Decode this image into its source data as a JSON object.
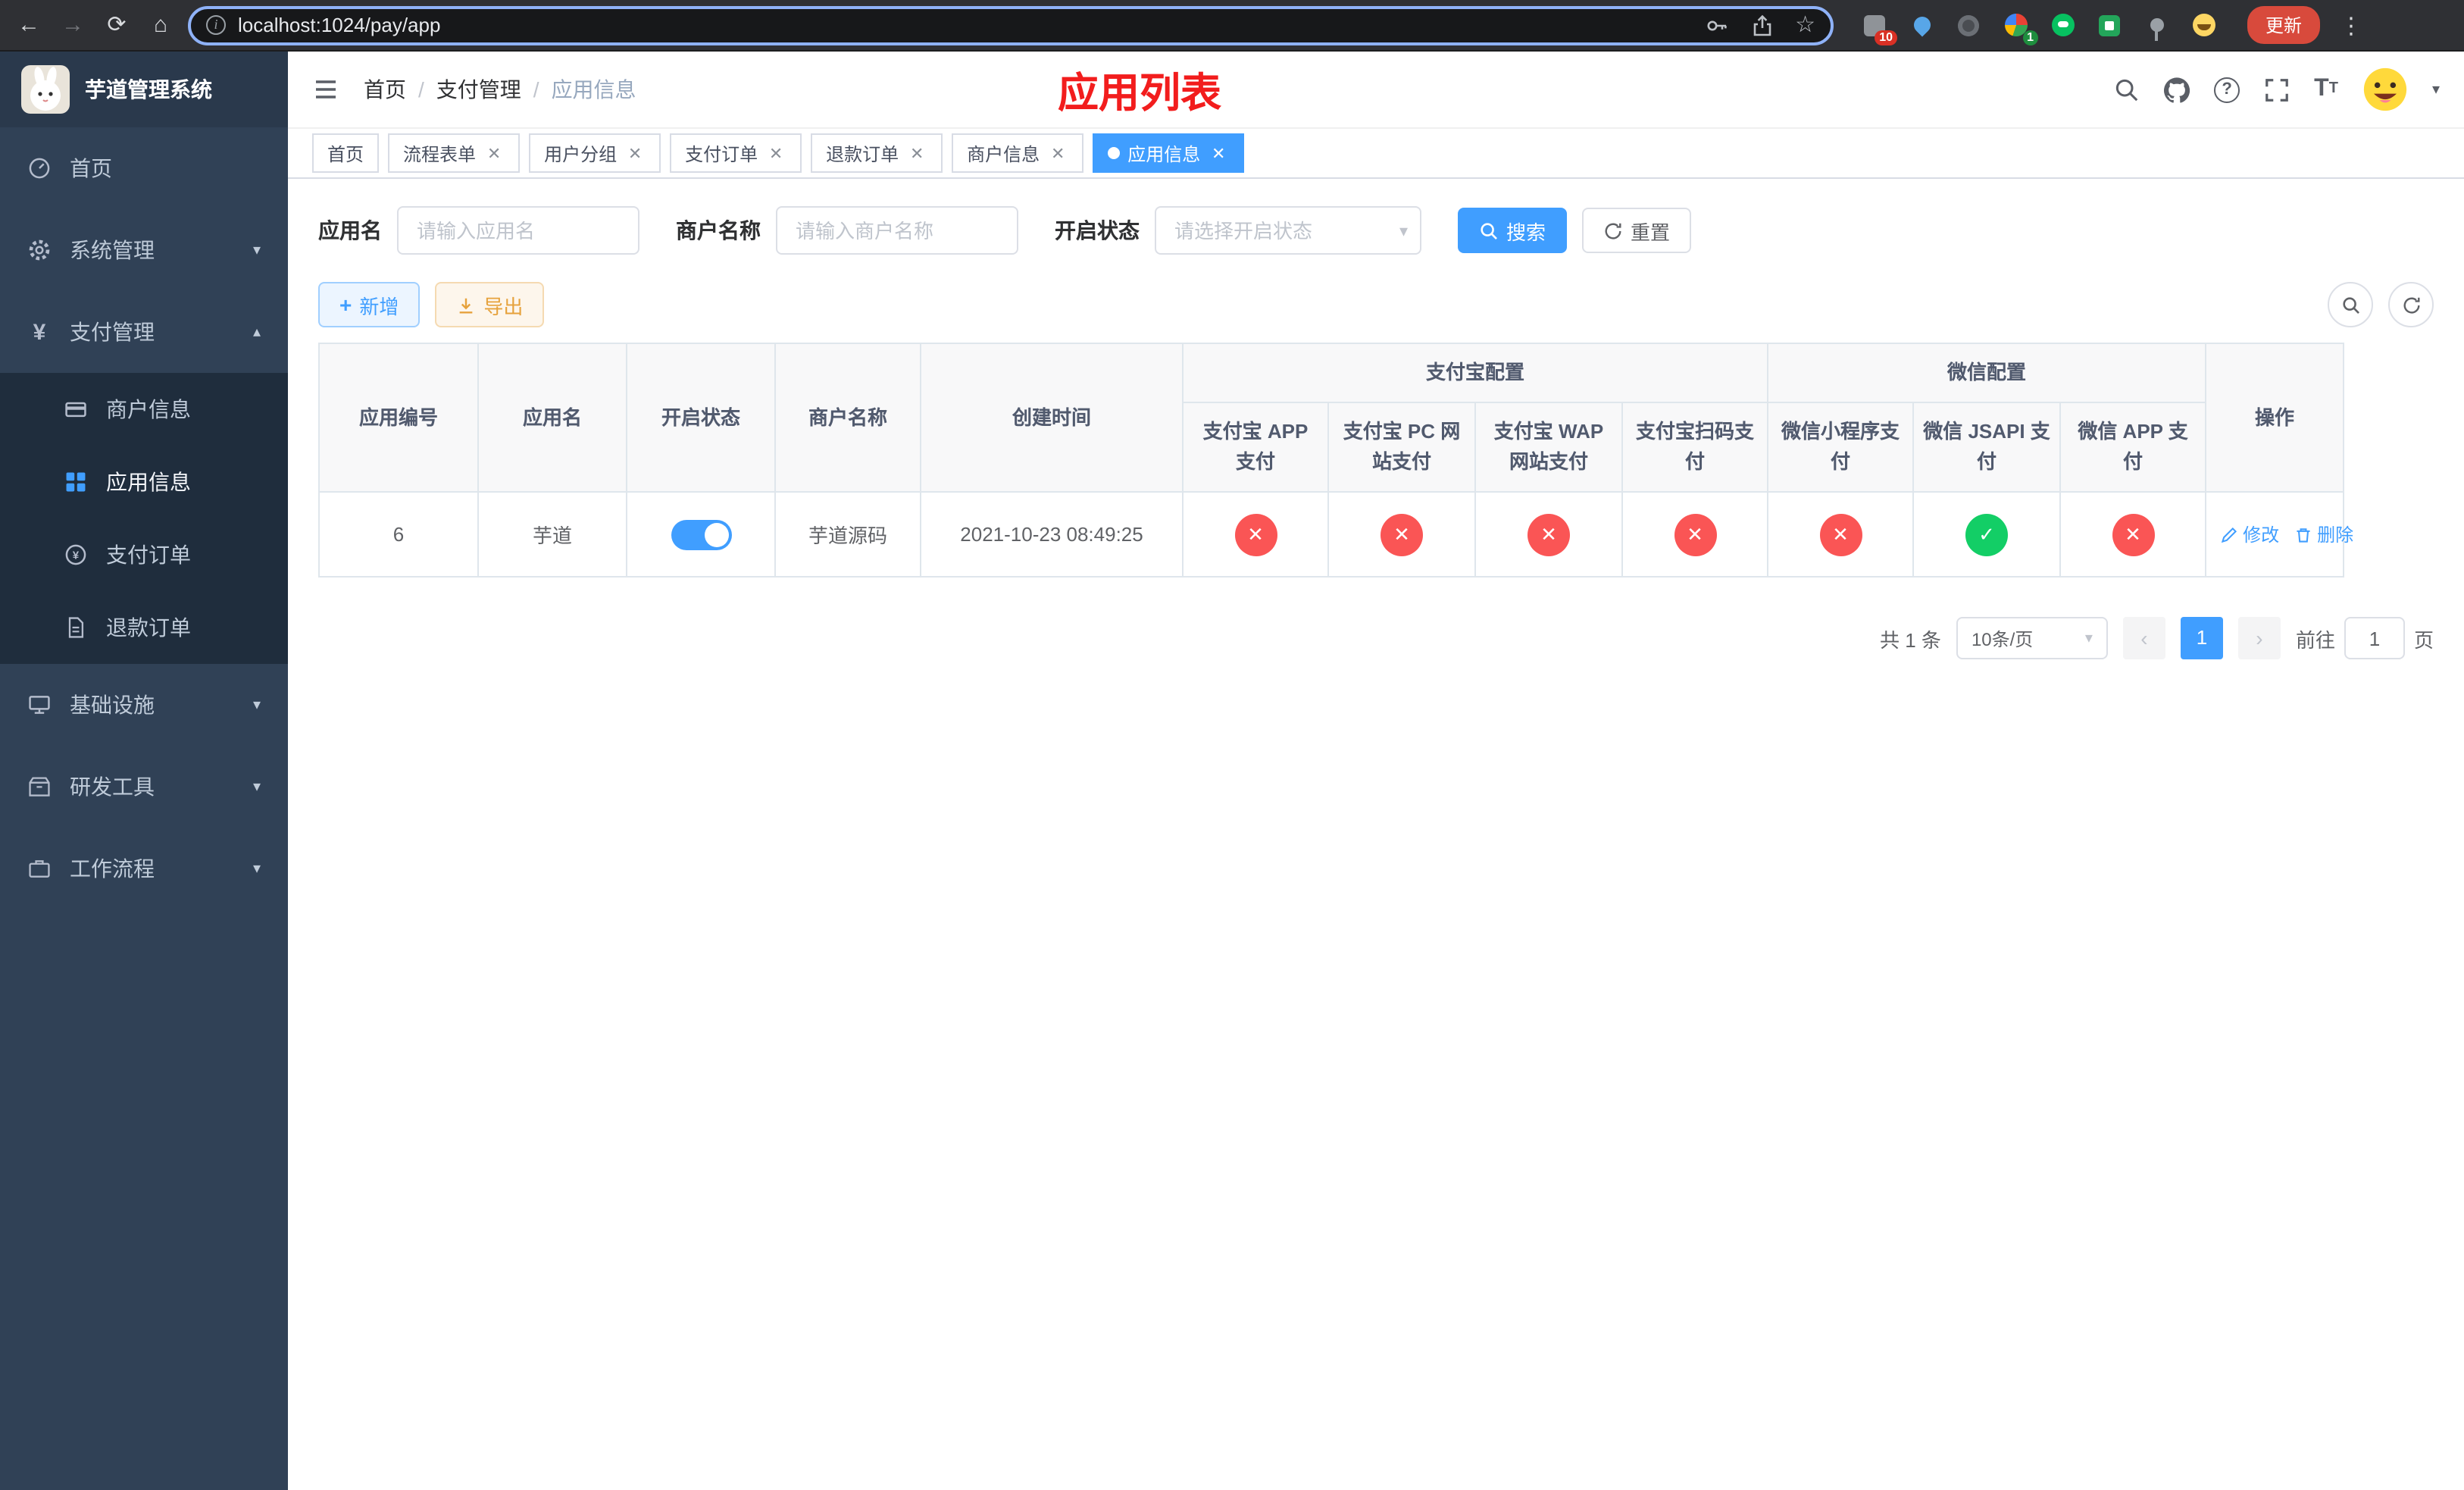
{
  "colors": {
    "accent": "#409eff",
    "danger": "#fa5555",
    "success": "#13ce66",
    "banner_red": "#f21d1d",
    "sidebar_bg": "#304156",
    "submenu_bg": "#1f2d3d"
  },
  "browser": {
    "url": "localhost:1024/pay/app",
    "update_label": "更新",
    "ext_badges": {
      "puzzle": "10",
      "profile": "1"
    }
  },
  "sidebar": {
    "title": "芋道管理系统",
    "items": [
      {
        "label": "首页"
      },
      {
        "label": "系统管理"
      },
      {
        "label": "支付管理"
      },
      {
        "label": "基础设施"
      },
      {
        "label": "研发工具"
      },
      {
        "label": "工作流程"
      }
    ],
    "pay_submenu": [
      {
        "label": "商户信息"
      },
      {
        "label": "应用信息"
      },
      {
        "label": "支付订单"
      },
      {
        "label": "退款订单"
      }
    ]
  },
  "header": {
    "breadcrumb": [
      "首页",
      "支付管理",
      "应用信息"
    ],
    "banner": "应用列表"
  },
  "tabs": [
    {
      "label": "首页"
    },
    {
      "label": "流程表单"
    },
    {
      "label": "用户分组"
    },
    {
      "label": "支付订单"
    },
    {
      "label": "退款订单"
    },
    {
      "label": "商户信息"
    },
    {
      "label": "应用信息"
    }
  ],
  "filters": {
    "app_name_label": "应用名",
    "app_name_placeholder": "请输入应用名",
    "merchant_label": "商户名称",
    "merchant_placeholder": "请输入商户名称",
    "status_label": "开启状态",
    "status_placeholder": "请选择开启状态",
    "search_label": "搜索",
    "reset_label": "重置"
  },
  "toolbar": {
    "add_label": "新增",
    "export_label": "导出"
  },
  "table": {
    "headers": {
      "app_id": "应用编号",
      "app_name": "应用名",
      "status": "开启状态",
      "merchant": "商户名称",
      "created": "创建时间",
      "alipay_group": "支付宝配置",
      "wechat_group": "微信配置",
      "alipay_cols": [
        "支付宝 APP 支付",
        "支付宝 PC 网站支付",
        "支付宝 WAP 网站支付",
        "支付宝扫码支付"
      ],
      "wechat_cols": [
        "微信小程序支付",
        "微信 JSAPI 支付",
        "微信 APP 支付"
      ],
      "actions": "操作"
    },
    "rows": [
      {
        "app_id": "6",
        "app_name": "芋道",
        "status_on": true,
        "merchant": "芋道源码",
        "created": "2021-10-23 08:49:25",
        "configs": [
          "disabled",
          "disabled",
          "disabled",
          "disabled",
          "disabled",
          "enabled",
          "disabled"
        ],
        "edit_label": "修改",
        "delete_label": "删除"
      }
    ]
  },
  "pagination": {
    "total_label": "共 1 条",
    "page_size": "10条/页",
    "current_page": "1",
    "goto_prefix": "前往",
    "goto_value": "1",
    "goto_suffix": "页"
  }
}
